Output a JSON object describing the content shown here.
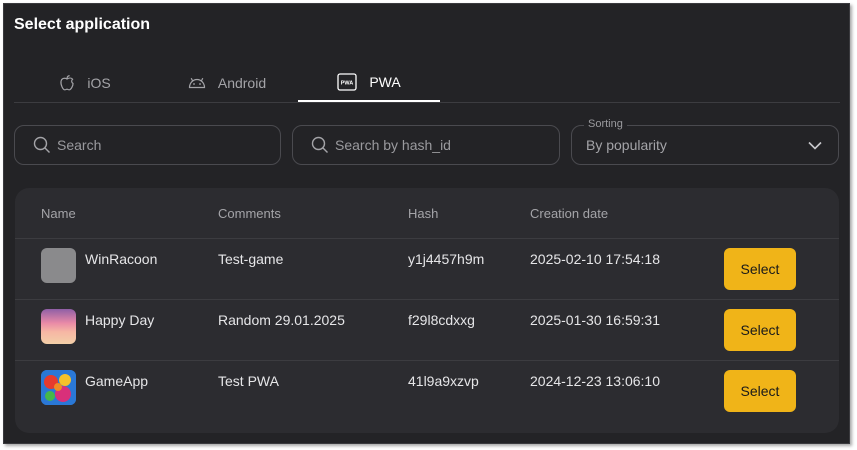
{
  "title": "Select application",
  "tabs": [
    {
      "label": "iOS",
      "icon": "apple-icon",
      "active": false
    },
    {
      "label": "Android",
      "icon": "android-icon",
      "active": false
    },
    {
      "label": "PWA",
      "icon": "pwa-icon",
      "active": true
    }
  ],
  "search": {
    "placeholder": "Search",
    "value": ""
  },
  "hash_search": {
    "placeholder": "Search by hash_id",
    "value": ""
  },
  "sorting": {
    "label": "Sorting",
    "value": "By popularity"
  },
  "table": {
    "columns": [
      "Name",
      "Comments",
      "Hash",
      "Creation date"
    ],
    "rows": [
      {
        "name": "WinRacoon",
        "comment": "Test-game",
        "hash": "y1j4457h9m",
        "date": "2025-02-10 17:54:18",
        "button": "Select",
        "icon": "gray-placeholder-icon"
      },
      {
        "name": "Happy Day",
        "comment": "Random 29.01.2025",
        "hash": "f29l8cdxxg",
        "date": "2025-01-30 16:59:31",
        "button": "Select",
        "icon": "sunset-app-icon"
      },
      {
        "name": "GameApp",
        "comment": "Test PWA",
        "hash": "41l9a9xzvp",
        "date": "2024-12-23 13:06:10",
        "button": "Select",
        "icon": "candy-app-icon"
      }
    ]
  },
  "colors": {
    "background": "#232326",
    "table_bg": "#2c2c30",
    "accent": "#f0b418",
    "text": "#e6e6e8",
    "muted": "#a4a4a8"
  }
}
